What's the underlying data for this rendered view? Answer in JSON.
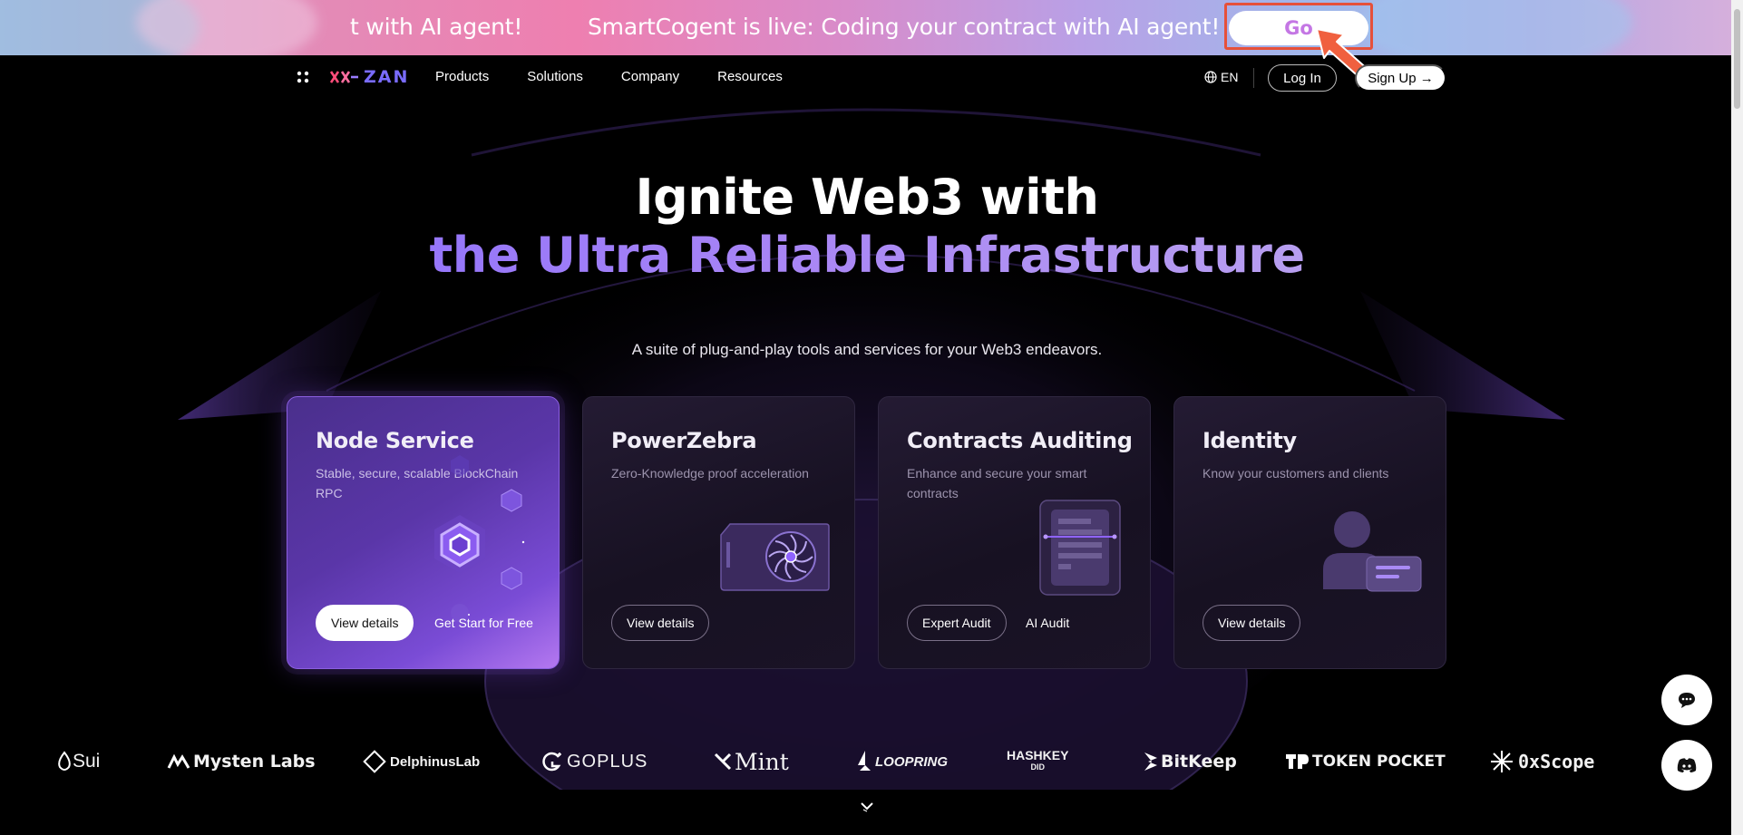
{
  "banner": {
    "text_partial": "t with AI agent!",
    "text": "SmartCogent is live: Coding your contract with AI agent!",
    "go_label": "Go"
  },
  "nav": {
    "logo_text": "ZAN",
    "links": [
      "Products",
      "Solutions",
      "Company",
      "Resources"
    ],
    "lang": "EN",
    "login": "Log In",
    "signup": "Sign Up →"
  },
  "hero": {
    "title_line1": "Ignite Web3 with",
    "title_line2": "the Ultra Reliable Infrastructure",
    "subtitle": "A suite of plug-and-play tools and services for your Web3 endeavors."
  },
  "cards": [
    {
      "title": "Node Service",
      "desc": "Stable, secure, scalable BlockChain RPC",
      "primary": "View details",
      "secondary": "Get Start for Free"
    },
    {
      "title": "PowerZebra",
      "desc": "Zero-Knowledge proof acceleration",
      "primary": "View details"
    },
    {
      "title": "Contracts Auditing",
      "desc": "Enhance and secure your smart contracts",
      "primary": "Expert Audit",
      "secondary": "AI Audit"
    },
    {
      "title": "Identity",
      "desc": "Know your customers and clients",
      "primary": "View details"
    }
  ],
  "partners": [
    "Sui",
    "Mysten Labs",
    "DelphinusLab",
    "GOPLUS",
    "Mint",
    "LOOPRING",
    "HASHKEY",
    "DID",
    "BitKeep",
    "TOKEN POCKET",
    "0xScope"
  ],
  "colors": {
    "accent": "#7f64ff",
    "card_active": "#5a36a8",
    "go_text": "#c477e4",
    "highlight_frame": "#e6503a"
  }
}
